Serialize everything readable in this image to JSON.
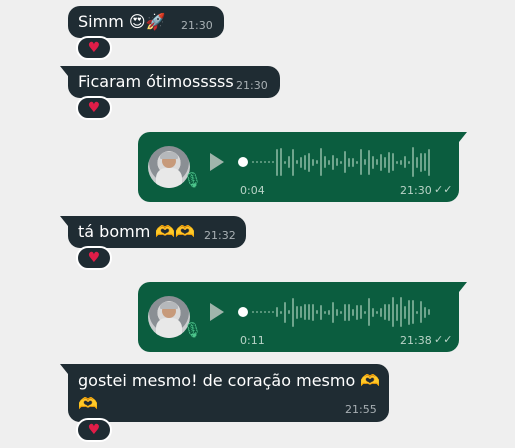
{
  "chat": {
    "messages": [
      {
        "text": "Simm",
        "emoji": "😍🚀",
        "time": "21:30",
        "reaction": "♥"
      },
      {
        "text": "Ficaram ótimosssss",
        "time": "21:30",
        "reaction": "♥"
      },
      {
        "type": "voice",
        "duration": "0:04",
        "time": "21:30"
      },
      {
        "text": "tá bomm",
        "emoji": "🫶🫶",
        "time": "21:32",
        "reaction": "♥"
      },
      {
        "type": "voice",
        "duration": "0:11",
        "time": "21:38"
      },
      {
        "text": "gostei mesmo! de coração mesmo",
        "emoji": "🫶",
        "emoji2": "🫶",
        "time": "21:55",
        "reaction": "♥"
      }
    ]
  },
  "icons": {
    "reaction": "heart-icon",
    "play": "play-icon",
    "mic": "microphone-icon",
    "read": "double-check-icon"
  },
  "colors": {
    "incoming_bubble": "#1f2c33",
    "outgoing_bubble": "#0b5d3f",
    "background": "#efefef",
    "heart": "#e11d48"
  }
}
